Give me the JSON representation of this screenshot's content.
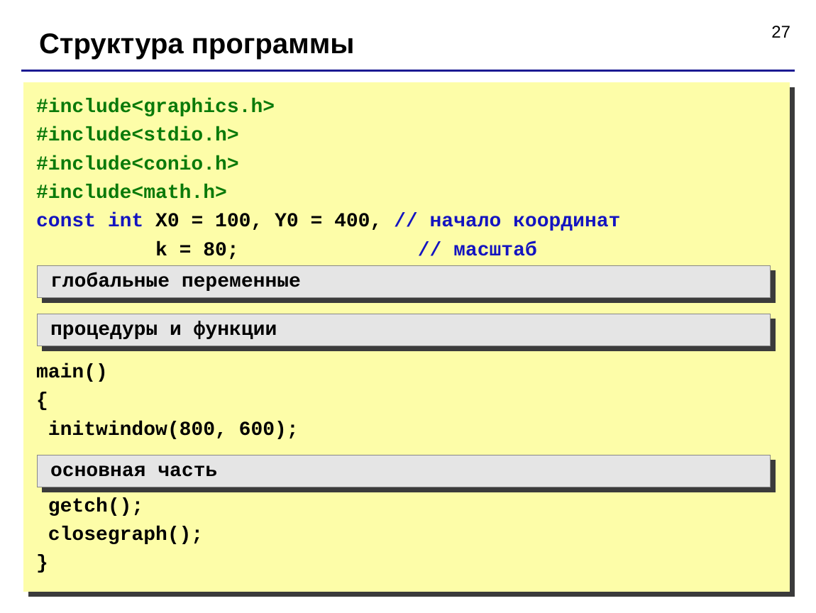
{
  "page_number": "27",
  "title": "Структура программы",
  "code": {
    "include1": "#include<graphics.h>",
    "include2": "#include<stdio.h>",
    "include3": "#include<conio.h>",
    "include4": "#include<math.h>",
    "const_prefix": "const int",
    "const_mid": " X0 = 100, Y0 = 400, ",
    "comment1": "// начало координат",
    "const_line2_code": "          k = 80;               ",
    "comment2": "// масштаб",
    "main_decl": "main()",
    "brace_open": "{",
    "initwindow": " initwindow(800, 600);",
    "getch": " getch();",
    "closegraph": " closegraph();",
    "brace_close": "}"
  },
  "labels": {
    "globals": "глобальные переменные",
    "procs": "процедуры и функции",
    "mainpart": "основная часть"
  }
}
